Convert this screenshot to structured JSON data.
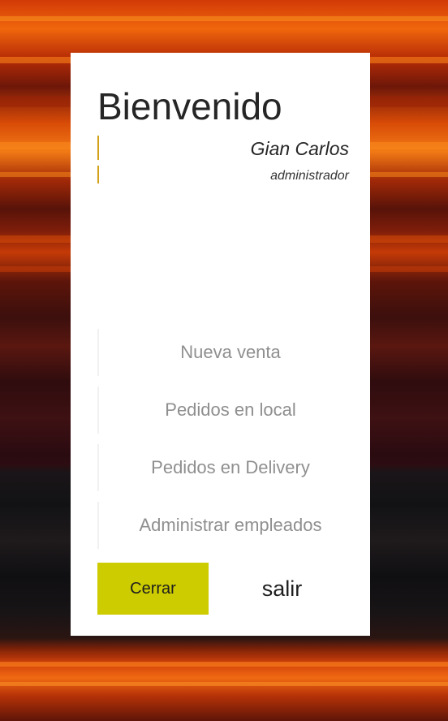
{
  "header": {
    "title": "Bienvenido",
    "user_name": "Gian Carlos",
    "user_role": "administrador"
  },
  "menu": {
    "items": [
      {
        "label": "Nueva venta"
      },
      {
        "label": "Pedidos en local"
      },
      {
        "label": "Pedidos en Delivery"
      },
      {
        "label": "Administrar empleados"
      }
    ]
  },
  "actions": {
    "close_label": "Cerrar",
    "exit_label": "salir"
  },
  "colors": {
    "accent": "#d4a11a",
    "close_button": "#cccc00",
    "menu_text": "#8f8f8f"
  }
}
